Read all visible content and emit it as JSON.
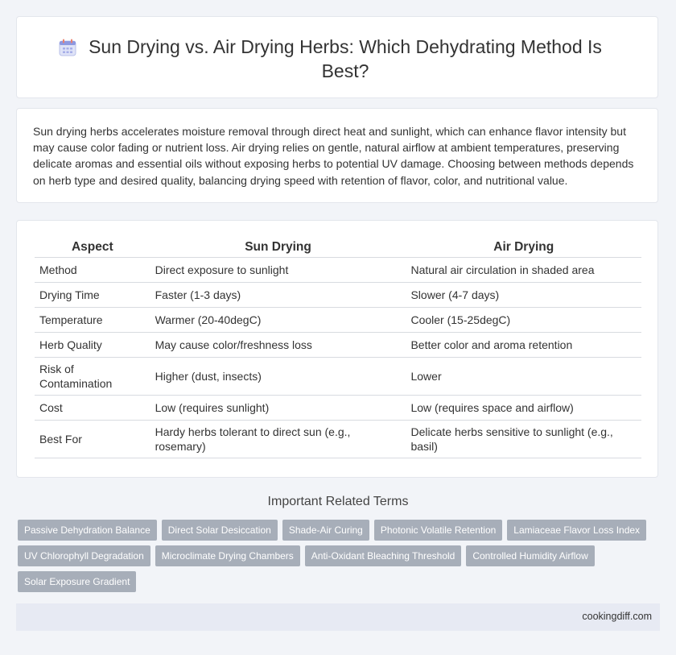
{
  "header": {
    "title": "Sun Drying vs. Air Drying Herbs: Which Dehydrating Method Is Best?",
    "icon": "calendar-icon"
  },
  "intro": {
    "text": "Sun drying herbs accelerates moisture removal through direct heat and sunlight, which can enhance flavor intensity but may cause color fading or nutrient loss. Air drying relies on gentle, natural airflow at ambient temperatures, preserving delicate aromas and essential oils without exposing herbs to potential UV damage. Choosing between methods depends on herb type and desired quality, balancing drying speed with retention of flavor, color, and nutritional value."
  },
  "table": {
    "headers": [
      "Aspect",
      "Sun Drying",
      "Air Drying"
    ],
    "rows": [
      [
        "Method",
        "Direct exposure to sunlight",
        "Natural air circulation in shaded area"
      ],
      [
        "Drying Time",
        "Faster (1-3 days)",
        "Slower (4-7 days)"
      ],
      [
        "Temperature",
        "Warmer (20-40degC)",
        "Cooler (15-25degC)"
      ],
      [
        "Herb Quality",
        "May cause color/freshness loss",
        "Better color and aroma retention"
      ],
      [
        "Risk of Contamination",
        "Higher (dust, insects)",
        "Lower"
      ],
      [
        "Cost",
        "Low (requires sunlight)",
        "Low (requires space and airflow)"
      ],
      [
        "Best For",
        "Hardy herbs tolerant to direct sun (e.g., rosemary)",
        "Delicate herbs sensitive to sunlight (e.g., basil)"
      ]
    ]
  },
  "related": {
    "title": "Important Related Terms",
    "tags": [
      "Passive Dehydration Balance",
      "Direct Solar Desiccation",
      "Shade-Air Curing",
      "Photonic Volatile Retention",
      "Lamiaceae Flavor Loss Index",
      "UV Chlorophyll Degradation",
      "Microclimate Drying Chambers",
      "Anti-Oxidant Bleaching Threshold",
      "Controlled Humidity Airflow",
      "Solar Exposure Gradient"
    ]
  },
  "footer": {
    "site": "cookingdiff.com"
  }
}
